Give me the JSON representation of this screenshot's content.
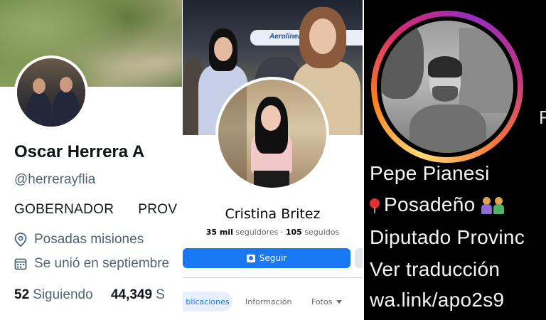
{
  "twitter": {
    "name": "Oscar Herrera A",
    "handle": "@herrerayflia",
    "bio_words": [
      "GOBERNADOR",
      "PROV"
    ],
    "location_icon": "map-pin-icon",
    "location": "Posadas misiones",
    "joined_icon": "calendar-icon",
    "joined": "Se unió en septiembre",
    "following_count": "52",
    "following_label": "Siguiendo",
    "followers_count": "44,349",
    "followers_label": "S"
  },
  "facebook": {
    "name": "Cristina Britez",
    "followers_count": "35 mil",
    "followers_label": "seguidores",
    "separator": "·",
    "following_count": "105",
    "following_label": "seguidos",
    "follow_button": "Seguir",
    "follow_icon": "follow-icon",
    "tabs": [
      "blicaciones",
      "Información",
      "Fotos"
    ],
    "cover_sign": "Aerolíneas",
    "accent": "#1877f2"
  },
  "instagram": {
    "name": "Pepe Pianesi",
    "location": "Posadeño",
    "location_icon": "pin-icon",
    "family_icon": "family-emoji-icon",
    "role": "Diputado Provinc",
    "translate": "Ver traducción",
    "link": "wa.link/apo2s9",
    "cut_letter": "F"
  }
}
